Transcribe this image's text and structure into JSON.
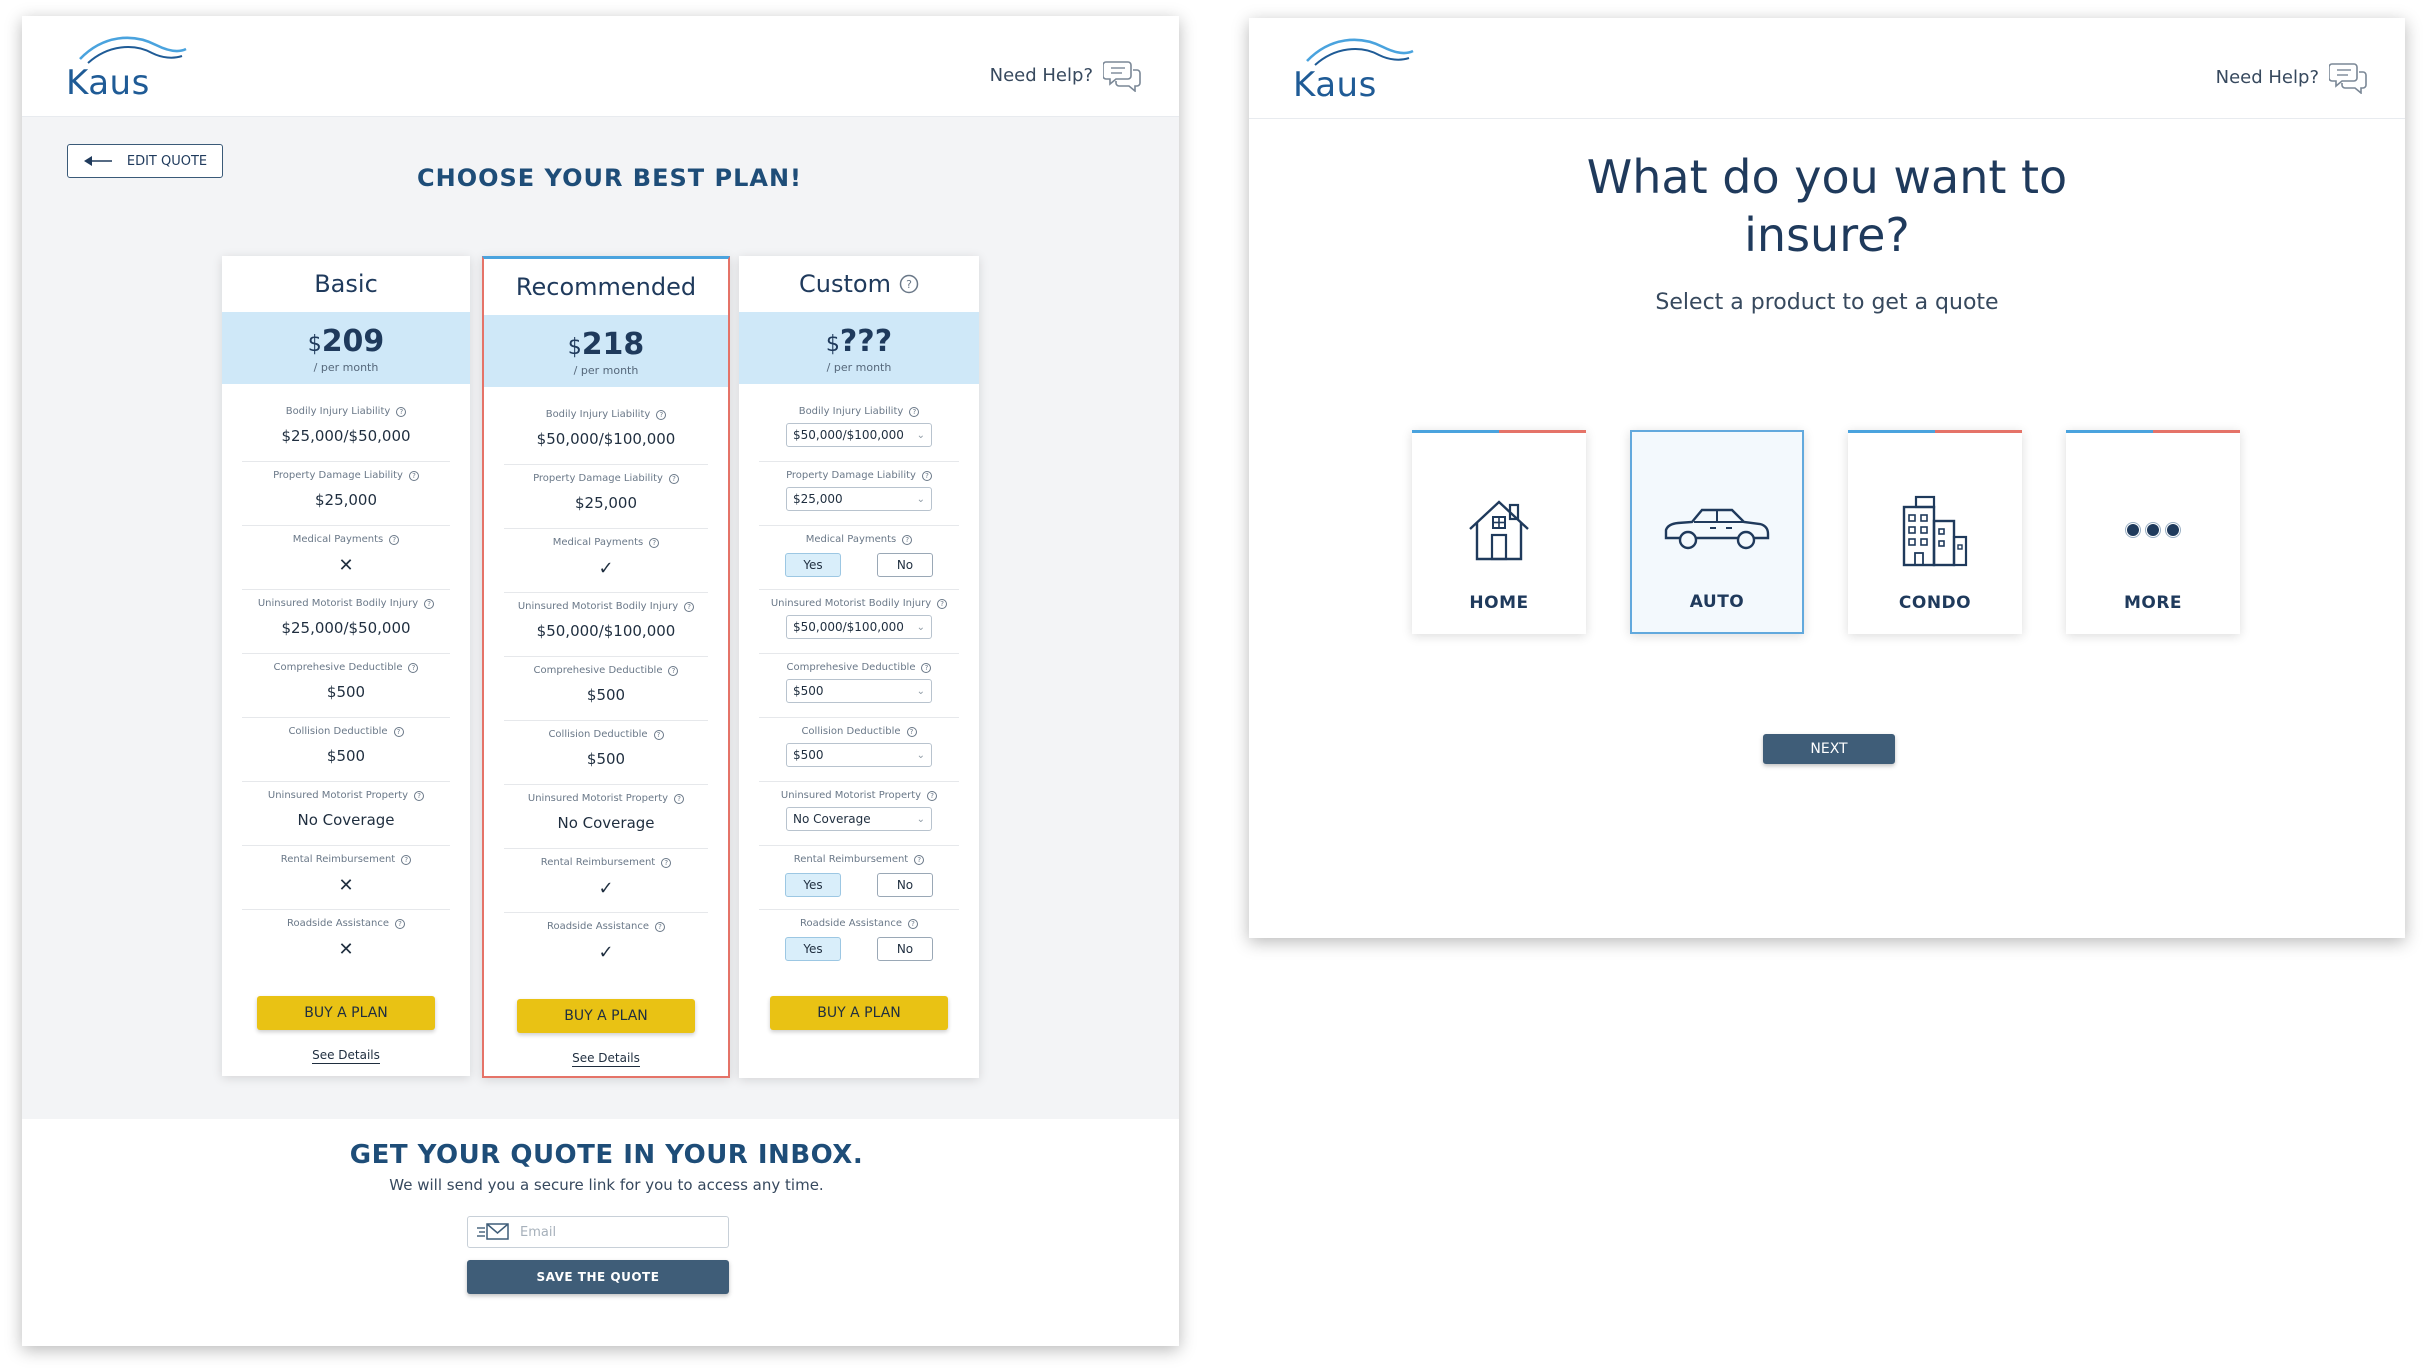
{
  "left_screen": {
    "brand": "Kaus",
    "help_label": "Need Help?",
    "edit_quote_label": "EDIT QUOTE",
    "title": "CHOOSE YOUR BEST PLAN!",
    "plans": [
      {
        "name": "Basic",
        "currency": "$",
        "price": "209",
        "per": "/ per month",
        "rows": [
          {
            "label": "Bodily Injury Liability",
            "value": "$25,000/$50,000"
          },
          {
            "label": "Property Damage Liability",
            "value": "$25,000"
          },
          {
            "label": "Medical Payments",
            "value": "✕"
          },
          {
            "label": "Uninsured Motorist Bodily Injury",
            "value": "$25,000/$50,000"
          },
          {
            "label": "Comprehesive Deductible",
            "value": "$500"
          },
          {
            "label": "Collision Deductible",
            "value": "$500"
          },
          {
            "label": "Uninsured Motorist Property",
            "value": "No Coverage"
          },
          {
            "label": "Rental Reimbursement",
            "value": "✕"
          },
          {
            "label": "Roadside Assistance",
            "value": "✕"
          }
        ],
        "buy_label": "BUY A PLAN",
        "details_label": "See Details"
      },
      {
        "name": "Recommended",
        "currency": "$",
        "price": "218",
        "per": "/ per month",
        "rows": [
          {
            "label": "Bodily Injury Liability",
            "value": "$50,000/$100,000"
          },
          {
            "label": "Property Damage Liability",
            "value": "$25,000"
          },
          {
            "label": "Medical Payments",
            "value": "✓"
          },
          {
            "label": "Uninsured Motorist Bodily Injury",
            "value": "$50,000/$100,000"
          },
          {
            "label": "Comprehesive Deductible",
            "value": "$500"
          },
          {
            "label": "Collision Deductible",
            "value": "$500"
          },
          {
            "label": "Uninsured Motorist Property",
            "value": "No Coverage"
          },
          {
            "label": "Rental Reimbursement",
            "value": "✓"
          },
          {
            "label": "Roadside Assistance",
            "value": "✓"
          }
        ],
        "buy_label": "BUY A PLAN",
        "details_label": "See Details"
      },
      {
        "name": "Custom",
        "currency": "$",
        "price": "???",
        "per": "/ per month",
        "rows": [
          {
            "label": "Bodily Injury Liability",
            "select": "$50,000/$100,000"
          },
          {
            "label": "Property Damage Liability",
            "select": "$25,000"
          },
          {
            "label": "Medical Payments",
            "yes": "Yes",
            "no": "No"
          },
          {
            "label": "Uninsured Motorist Bodily Injury",
            "select": "$50,000/$100,000"
          },
          {
            "label": "Comprehesive Deductible",
            "select": "$500"
          },
          {
            "label": "Collision Deductible",
            "select": "$500"
          },
          {
            "label": "Uninsured Motorist Property",
            "select": "No Coverage"
          },
          {
            "label": "Rental Reimbursement",
            "yes": "Yes",
            "no": "No"
          },
          {
            "label": "Roadside Assistance",
            "yes": "Yes",
            "no": "No"
          }
        ],
        "buy_label": "BUY A PLAN"
      }
    ],
    "inbox_title": "GET YOUR QUOTE IN YOUR INBOX.",
    "inbox_subtitle": "We will send you a secure link for you to access any time.",
    "email_placeholder": "Email",
    "save_label": "SAVE THE QUOTE"
  },
  "right_screen": {
    "brand": "Kaus",
    "help_label": "Need Help?",
    "title_line1": "What do you want to",
    "title_line2": "insure?",
    "subtitle": "Select a product to get a quote",
    "products": [
      {
        "label": "HOME",
        "icon": "house-icon"
      },
      {
        "label": "AUTO",
        "icon": "car-icon"
      },
      {
        "label": "CONDO",
        "icon": "building-icon"
      },
      {
        "label": "MORE",
        "icon": "more-dots-icon"
      }
    ],
    "next_label": "NEXT"
  },
  "colors": {
    "accent_blue": "#4aa3de",
    "accent_coral": "#e57368",
    "price_band": "#cfe8f8",
    "buy_yellow": "#e9c214",
    "dark_button": "#3f5d78",
    "navy_text": "#1f3a5c"
  }
}
